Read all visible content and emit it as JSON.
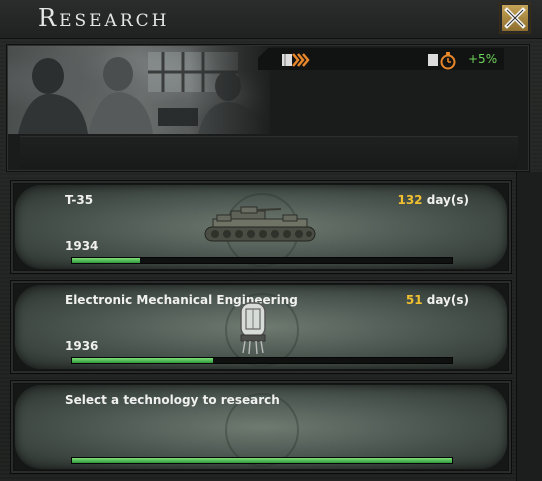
{
  "window": {
    "title": "Research",
    "close_icon": "close-x-icon"
  },
  "header": {
    "image": "scientists-at-work-photo",
    "research_speed_icon": "research-speed-arrows-icon",
    "bonus_icon": "research-bonus-clock-icon",
    "research_bonus": "+5%",
    "bonus_color": "#6fd45a"
  },
  "slots": [
    {
      "name": "T-35",
      "days": "132",
      "days_unit": "day(s)",
      "year": "1934",
      "progress": 0.18,
      "icon": "heavy-tank-icon"
    },
    {
      "name": "Electronic Mechanical Engineering",
      "days": "51",
      "days_unit": "day(s)",
      "year": "1936",
      "progress": 0.37,
      "icon": "vacuum-tube-icon"
    },
    {
      "name": "Select a technology to research",
      "progress": 1.0
    }
  ],
  "colors": {
    "days_number": "#f0c030",
    "progress_green": "#2f9a3a"
  }
}
